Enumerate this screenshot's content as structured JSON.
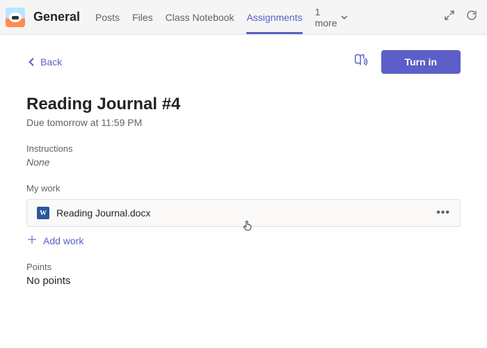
{
  "topbar": {
    "channel": "General",
    "tabs": [
      "Posts",
      "Files",
      "Class Notebook",
      "Assignments"
    ],
    "active_tab_index": 3,
    "more_label": "1 more"
  },
  "header": {
    "back_label": "Back",
    "turnin_label": "Turn in"
  },
  "assignment": {
    "title": "Reading Journal #4",
    "due": "Due tomorrow at 11:59 PM",
    "instructions_label": "Instructions",
    "instructions_value": "None",
    "mywork_label": "My work",
    "file_name": "Reading Journal.docx",
    "add_work_label": "Add work",
    "points_label": "Points",
    "points_value": "No points"
  }
}
